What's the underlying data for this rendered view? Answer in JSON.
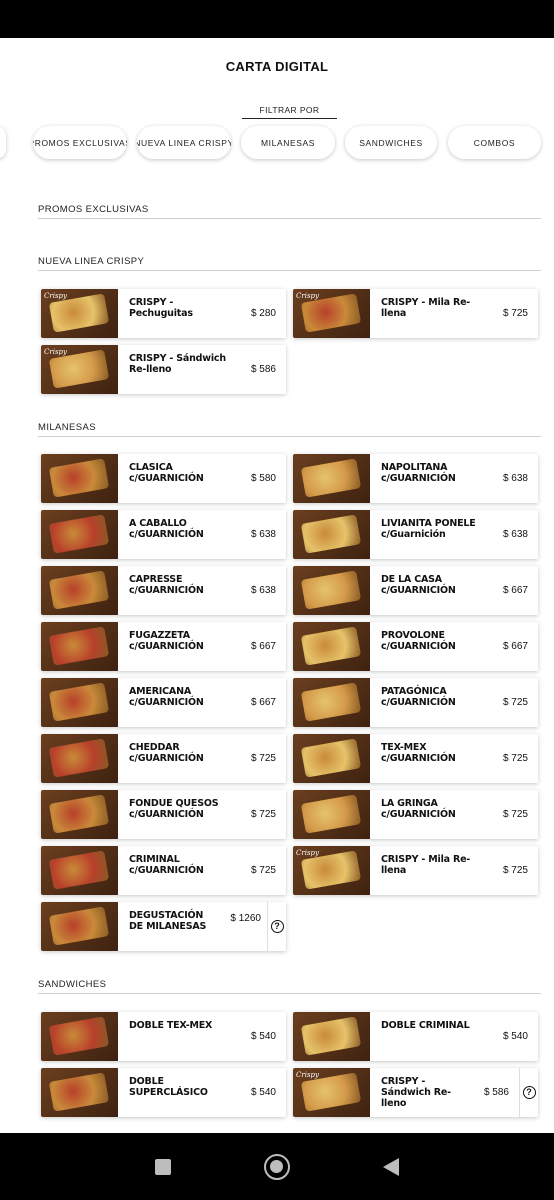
{
  "header": {
    "title": "CARTA DIGITAL"
  },
  "filter": {
    "label": "FILTRAR POR",
    "chips": [
      "PROMOS EXCLUSIVAS",
      "NUEVA LINEA CRISPY",
      "MILANESAS",
      "SANDWICHES",
      "COMBOS"
    ]
  },
  "sections": {
    "promos": {
      "title": "PROMOS EXCLUSIVAS"
    },
    "crispy": {
      "title": "NUEVA LINEA CRISPY",
      "items": [
        {
          "name": "CRISPY - Pechuguitas",
          "price": "$ 280"
        },
        {
          "name": "CRISPY - Mila Re-llena",
          "price": "$ 725"
        },
        {
          "name": "CRISPY - Sándwich Re-lleno",
          "price": "$ 586"
        }
      ]
    },
    "milanesas": {
      "title": "MILANESAS",
      "items": [
        {
          "name": "CLASICA c/GUARNICIÓN",
          "price": "$ 580"
        },
        {
          "name": "NAPOLITANA c/GUARNICIÓN",
          "price": "$ 638"
        },
        {
          "name": "A CABALLO c/GUARNICIÓN",
          "price": "$ 638"
        },
        {
          "name": "LIVIANITA PONELE c/Guarnición",
          "price": "$ 638"
        },
        {
          "name": "CAPRESSE c/GUARNICIÓN",
          "price": "$ 638"
        },
        {
          "name": "DE LA CASA c/GUARNICIÓN",
          "price": "$ 667"
        },
        {
          "name": "FUGAZZETA c/GUARNICIÓN",
          "price": "$ 667"
        },
        {
          "name": "PROVOLONE c/GUARNICIÓN",
          "price": "$ 667"
        },
        {
          "name": "AMERICANA c/GUARNICIÓN",
          "price": "$ 667"
        },
        {
          "name": "PATAGÓNICA c/GUARNICIÓN",
          "price": "$ 725"
        },
        {
          "name": "CHEDDAR c/GUARNICIÓN",
          "price": "$ 725"
        },
        {
          "name": "TEX-MEX c/GUARNICIÓN",
          "price": "$ 725"
        },
        {
          "name": "FONDUE QUESOS c/GUARNICIÓN",
          "price": "$ 725"
        },
        {
          "name": "LA GRINGA c/GUARNICIÓN",
          "price": "$ 725"
        },
        {
          "name": "CRIMINAL c/GUARNICIÓN",
          "price": "$ 725"
        },
        {
          "name": "CRISPY - Mila Re-llena",
          "price": "$ 725"
        },
        {
          "name": "DEGUSTACIÓN DE MILANESAS",
          "price": "$ 1260"
        }
      ]
    },
    "sandwiches": {
      "title": "SANDWICHES",
      "items": [
        {
          "name": "DOBLE TEX-MEX",
          "price": "$ 540"
        },
        {
          "name": "DOBLE CRIMINAL",
          "price": "$ 540"
        },
        {
          "name": "DOBLE SUPERCLÁSICO",
          "price": "$ 540"
        },
        {
          "name": "CRISPY - Sándwich Re-lleno",
          "price": "$ 586"
        }
      ]
    }
  },
  "thumb_tag": "Crispy",
  "info_glyph": "?",
  "colors": {
    "wood": "#6b3f1f",
    "breaded": "#c98a3a",
    "sauce": "#b8402a",
    "cheese": "#e6c36a"
  },
  "icons": [
    "info-icon",
    "nav-recents-icon",
    "nav-home-icon",
    "nav-back-icon"
  ]
}
